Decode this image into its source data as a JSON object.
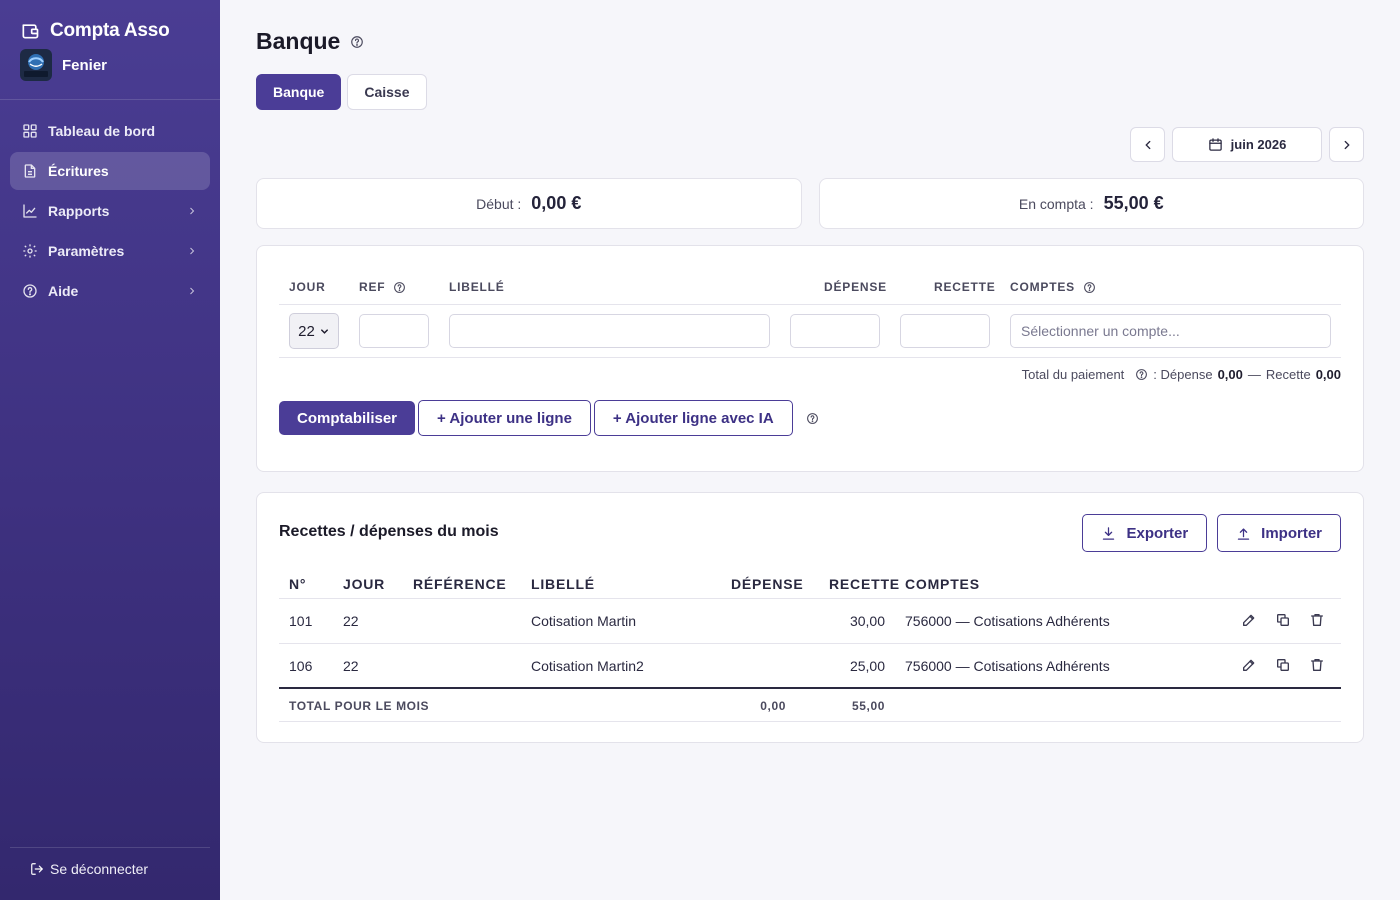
{
  "app": {
    "name": "Compta Asso",
    "org_name": "Fenier",
    "org_logo_text": "FENIER"
  },
  "sidebar": {
    "items": [
      {
        "label": "Tableau de bord",
        "icon": "dashboard-icon"
      },
      {
        "label": "Écritures",
        "icon": "document-icon",
        "active": true
      },
      {
        "label": "Rapports",
        "icon": "chart-line-icon"
      },
      {
        "label": "Paramètres",
        "icon": "gear-icon"
      },
      {
        "label": "Aide",
        "icon": "help-circle-icon"
      }
    ],
    "logout_label": "Se déconnecter"
  },
  "page": {
    "title": "Banque"
  },
  "tabs": [
    {
      "label": "Banque",
      "active": true
    },
    {
      "label": "Caisse"
    }
  ],
  "period": {
    "label": "juin 2026"
  },
  "summary": {
    "start_label": "Début :",
    "start_value": "0,00 €",
    "compta_label": "En compta :",
    "compta_value": "55,00 €"
  },
  "entry_form": {
    "headers": {
      "day": "JOUR",
      "ref": "REF",
      "label": "LIBELLÉ",
      "expense": "DÉPENSE",
      "income": "RECETTE",
      "accounts": "COMPTES"
    },
    "day_value": "22",
    "account_placeholder": "Sélectionner un compte...",
    "totals": {
      "prefix": "Total du paiement",
      "expense_label": ": Dépense",
      "expense_value": "0,00",
      "sep": "—",
      "income_label": "Recette",
      "income_value": "0,00"
    },
    "buttons": {
      "submit": "Comptabiliser",
      "add_line": "+ Ajouter une ligne",
      "add_ai": "+ Ajouter ligne avec IA"
    }
  },
  "transactions": {
    "title": "Recettes / dépenses du mois",
    "export_label": "Exporter",
    "import_label": "Importer",
    "headers": {
      "num": "N°",
      "day": "JOUR",
      "ref": "RÉFÉRENCE",
      "label": "LIBELLÉ",
      "expense": "DÉPENSE",
      "income": "RECETTE",
      "accounts": "COMPTES"
    },
    "rows": [
      {
        "num": "101",
        "day": "22",
        "ref": "",
        "label": "Cotisation Martin",
        "expense": "",
        "income": "30,00",
        "account": "756000 — Cotisations Adhérents"
      },
      {
        "num": "106",
        "day": "22",
        "ref": "",
        "label": "Cotisation Martin2",
        "expense": "",
        "income": "25,00",
        "account": "756000 — Cotisations Adhérents"
      }
    ],
    "footer": {
      "label": "TOTAL POUR LE MOIS",
      "expense": "0,00",
      "income": "55,00"
    }
  },
  "colors": {
    "primary": "#4b3d97",
    "sidebar_top": "#4a3d93",
    "sidebar_bottom": "#33286e",
    "background": "#f6f6fa"
  }
}
